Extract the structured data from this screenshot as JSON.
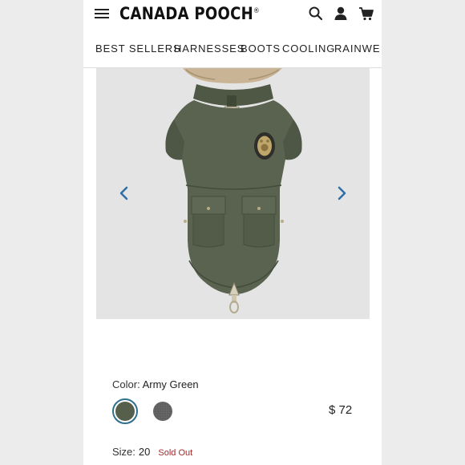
{
  "header": {
    "brand": "CANADA POOCH",
    "brand_mark": "®",
    "icons": [
      "menu-icon",
      "search-icon",
      "user-icon",
      "cart-icon"
    ]
  },
  "nav": {
    "items": [
      "BEST SELLERS",
      "HARNESSES",
      "BOOTS",
      "COOLING",
      "RAINWE"
    ]
  },
  "gallery": {
    "prev_icon": "chevron-left-icon",
    "next_icon": "chevron-right-icon"
  },
  "product": {
    "color_label": "Color:",
    "color_value": "Army Green",
    "swatches": [
      {
        "name": "Army Green",
        "color": "#555f4c",
        "selected": true
      },
      {
        "name": "Charcoal",
        "color": "#5e5e5e",
        "selected": false
      }
    ],
    "price": "$ 72",
    "size_label": "Size:",
    "size_value": "20",
    "size_status": "Sold Out"
  },
  "colors": {
    "accent": "#2f6fa6",
    "sold_out": "#a5282a",
    "coat": "#5a6350"
  }
}
